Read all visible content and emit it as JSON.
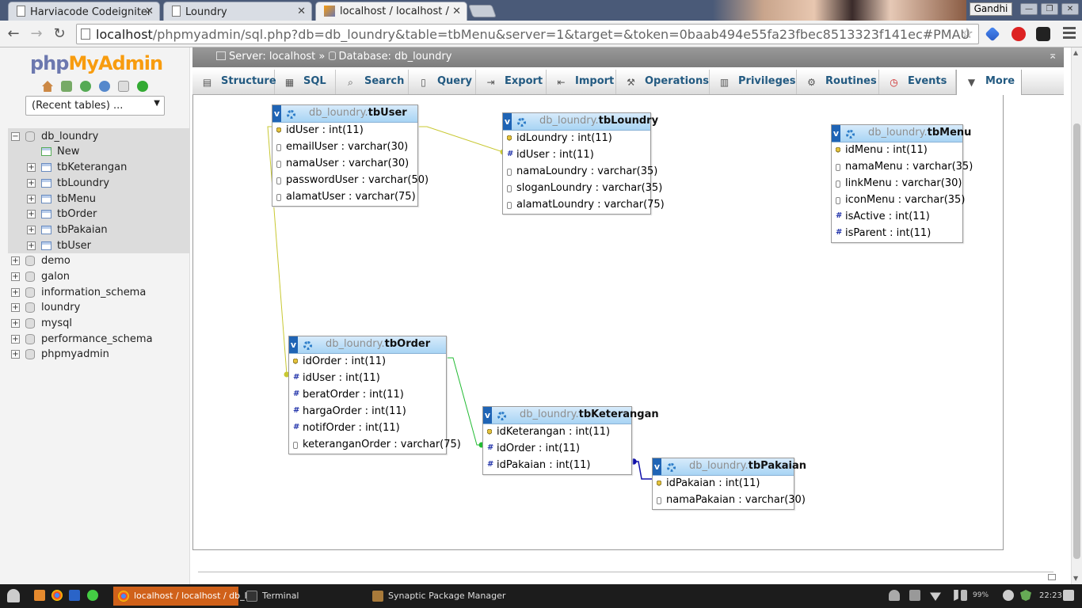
{
  "browser": {
    "tabs": [
      {
        "title": "Harviacode Codeigniter",
        "active": false
      },
      {
        "title": "Loundry",
        "active": false
      },
      {
        "title": "localhost / localhost / db_loundry",
        "active": true
      }
    ],
    "profile": "Gandhi",
    "url_host": "localhost",
    "url_rest": "/phpmyadmin/sql.php?db=db_loundry&table=tbMenu&server=1&target=&token=0baab494e55fa23fbec8513323f141ec#PMAU",
    "window_buttons": [
      "—",
      "❐",
      "✕"
    ]
  },
  "nav": {
    "logo_a": "php",
    "logo_b": "MyAdmin",
    "recent_tables": "(Recent tables) ...",
    "open_db": "db_loundry",
    "new_label": "New",
    "tables": [
      "tbKeterangan",
      "tbLoundry",
      "tbMenu",
      "tbOrder",
      "tbPakaian",
      "tbUser"
    ],
    "databases": [
      "demo",
      "galon",
      "information_schema",
      "loundry",
      "mysql",
      "performance_schema",
      "phpmyadmin"
    ]
  },
  "breadcrumb": {
    "server": "Server: localhost",
    "sep": "»",
    "database": "Database: db_loundry"
  },
  "menu_tabs": [
    "Structure",
    "SQL",
    "Search",
    "Query",
    "Export",
    "Import",
    "Operations",
    "Privileges",
    "Routines",
    "Events",
    "More"
  ],
  "designer": {
    "tables": [
      {
        "db": "db_loundry.",
        "name": "tbUser",
        "columns": [
          {
            "type": "key",
            "text": "idUser : int(11)"
          },
          {
            "type": "txt",
            "text": "emailUser : varchar(30)"
          },
          {
            "type": "txt",
            "text": "namaUser : varchar(30)"
          },
          {
            "type": "txt",
            "text": "passwordUser : varchar(50)"
          },
          {
            "type": "txt",
            "text": "alamatUser : varchar(75)"
          }
        ]
      },
      {
        "db": "db_loundry.",
        "name": "tbLoundry",
        "columns": [
          {
            "type": "key",
            "text": "idLoundry : int(11)"
          },
          {
            "type": "num",
            "text": "idUser : int(11)"
          },
          {
            "type": "txt",
            "text": "namaLoundry : varchar(35)"
          },
          {
            "type": "txt",
            "text": "sloganLoundry : varchar(35)"
          },
          {
            "type": "txt",
            "text": "alamatLoundry : varchar(75)"
          }
        ]
      },
      {
        "db": "db_loundry.",
        "name": "tbMenu",
        "columns": [
          {
            "type": "key",
            "text": "idMenu : int(11)"
          },
          {
            "type": "txt",
            "text": "namaMenu : varchar(35)"
          },
          {
            "type": "txt",
            "text": "linkMenu : varchar(30)"
          },
          {
            "type": "txt",
            "text": "iconMenu : varchar(35)"
          },
          {
            "type": "num",
            "text": "isActive : int(11)"
          },
          {
            "type": "num",
            "text": "isParent : int(11)"
          }
        ]
      },
      {
        "db": "db_loundry.",
        "name": "tbOrder",
        "columns": [
          {
            "type": "key",
            "text": "idOrder : int(11)"
          },
          {
            "type": "num",
            "text": "idUser : int(11)"
          },
          {
            "type": "num",
            "text": "beratOrder : int(11)"
          },
          {
            "type": "num",
            "text": "hargaOrder : int(11)"
          },
          {
            "type": "num",
            "text": "notifOrder : int(11)"
          },
          {
            "type": "txt",
            "text": "keteranganOrder : varchar(75)"
          }
        ]
      },
      {
        "db": "db_loundry.",
        "name": "tbKeterangan",
        "columns": [
          {
            "type": "key",
            "text": "idKeterangan : int(11)"
          },
          {
            "type": "num",
            "text": "idOrder : int(11)"
          },
          {
            "type": "num",
            "text": "idPakaian : int(11)"
          }
        ]
      },
      {
        "db": "db_loundry.",
        "name": "tbPakaian",
        "columns": [
          {
            "type": "key",
            "text": "idPakaian : int(11)"
          },
          {
            "type": "txt",
            "text": "namaPakaian : varchar(30)"
          }
        ]
      }
    ],
    "relation_colors": {
      "user": "#c8c832",
      "order": "#22bb33",
      "pakaian": "#1111aa"
    }
  },
  "taskbar": {
    "apps": [
      "localhost / localhost / db_l…",
      "Terminal",
      "Synaptic Package Manager"
    ],
    "battery": "99%",
    "clock": "22:23"
  }
}
